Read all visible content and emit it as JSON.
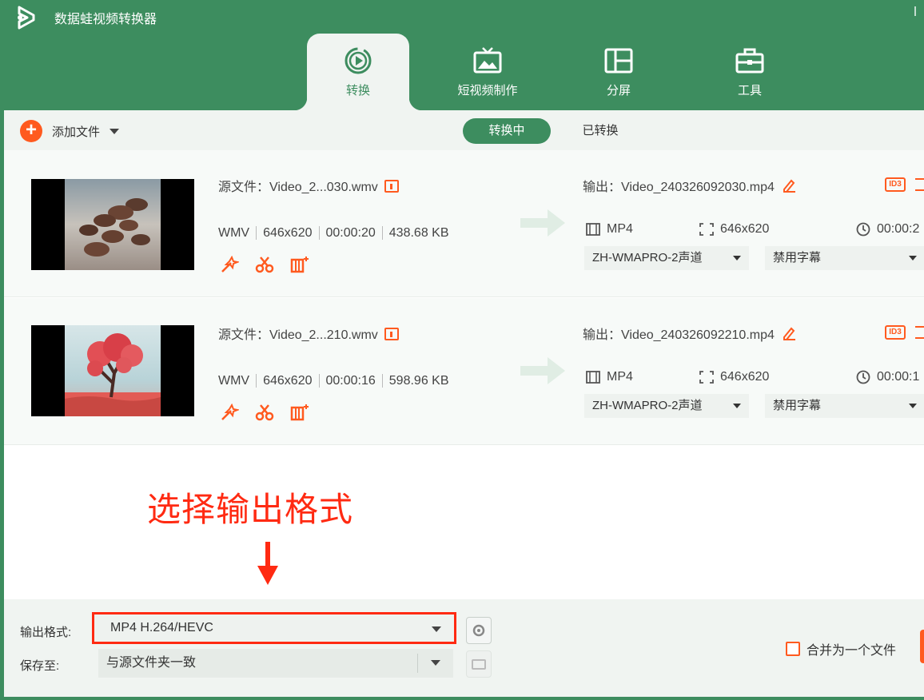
{
  "app": {
    "title": "数据蛙视频转换器",
    "logo_icon": "app-logo-icon"
  },
  "tabs": [
    {
      "label": "转换",
      "icon": "convert-icon",
      "active": true
    },
    {
      "label": "短视频制作",
      "icon": "tv-icon",
      "active": false
    },
    {
      "label": "分屏",
      "icon": "split-screen-icon",
      "active": false
    },
    {
      "label": "工具",
      "icon": "toolbox-icon",
      "active": false
    }
  ],
  "toolbar": {
    "add_files": "添加文件",
    "converting": "转换中",
    "converted": "已转换"
  },
  "files": [
    {
      "source": "源文件：Video_2...030.wmv",
      "format": "WMV",
      "resolution": "646x620",
      "duration": "00:00:20",
      "size": "438.68 KB",
      "output": "输出：Video_240326092030.mp4",
      "out_format": "MP4",
      "out_resolution": "646x620",
      "out_duration": "00:00:2",
      "audio": "ZH-WMAPRO-2声道",
      "subtitle": "禁用字幕"
    },
    {
      "source": "源文件：Video_2...210.wmv",
      "format": "WMV",
      "resolution": "646x620",
      "duration": "00:00:16",
      "size": "598.96 KB",
      "output": "输出：Video_240326092210.mp4",
      "out_format": "MP4",
      "out_resolution": "646x620",
      "out_duration": "00:00:1",
      "audio": "ZH-WMAPRO-2声道",
      "subtitle": "禁用字幕"
    }
  ],
  "id3_label": "ID3",
  "annotation": {
    "text": "选择输出格式"
  },
  "bottom": {
    "output_format_label": "输出格式:",
    "output_format_value": "MP4 H.264/HEVC",
    "save_to_label": "保存至:",
    "save_to_value": "与源文件夹一致",
    "merge_label": "合并为一个文件"
  },
  "colors": {
    "brand_green": "#3d8d5f",
    "accent_orange": "#ff5a1f",
    "annotation_red": "#ff2a12"
  }
}
